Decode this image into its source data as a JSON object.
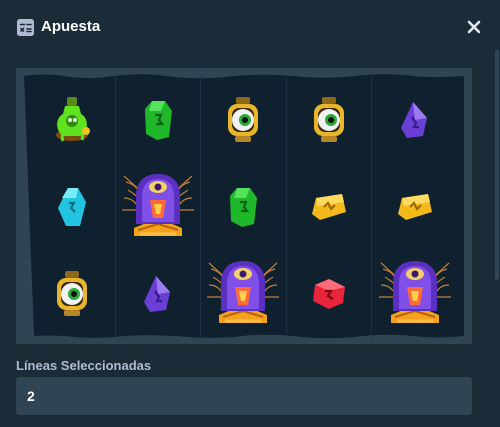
{
  "header": {
    "title": "Apuesta",
    "title_icon": "sliders-icon",
    "close_icon": "close-icon"
  },
  "reels": {
    "rows": [
      [
        "green-potion",
        "green-rune-gem",
        "eyeball-lantern",
        "eyeball-lantern",
        "purple-rune-gem"
      ],
      [
        "cyan-rune-gem",
        "eye-idol-web",
        "green-rune-gem",
        "gold-rune-tile",
        "gold-rune-tile"
      ],
      [
        "eyeball-lantern",
        "purple-rune-gem",
        "eye-idol-web",
        "red-rune-gem",
        "eye-idol-web"
      ]
    ]
  },
  "lines": {
    "label": "Líneas Seleccionadas",
    "value": "2"
  },
  "colors": {
    "panel_bg": "#1a2c38",
    "reel_bg": "#0f212e",
    "input_bg": "#2f4553",
    "label": "#b1bad3"
  }
}
